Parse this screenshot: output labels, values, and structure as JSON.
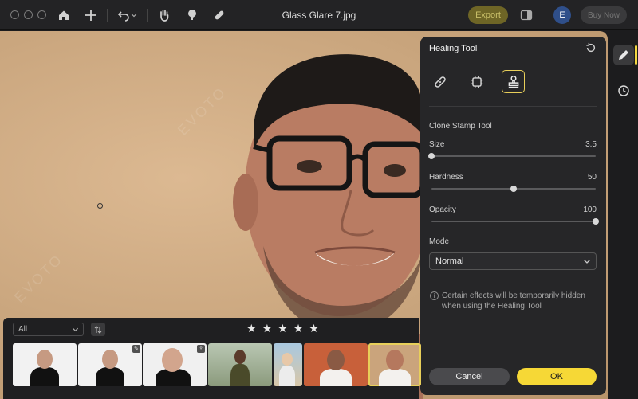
{
  "window": {
    "title": "Glass Glare 7.jpg"
  },
  "toolbar": {
    "export_label": "Export",
    "avatar_initial": "E",
    "buy_label": "Buy Now"
  },
  "panel": {
    "title": "Healing Tool",
    "tools": [
      {
        "name": "bandage-icon"
      },
      {
        "name": "chip-icon"
      },
      {
        "name": "stamp-icon",
        "active": true
      }
    ],
    "section": "Clone Stamp Tool",
    "sliders": [
      {
        "label": "Size",
        "value": "3.5",
        "fraction": 0.0
      },
      {
        "label": "Hardness",
        "value": "50",
        "fraction": 0.5
      },
      {
        "label": "Opacity",
        "value": "100",
        "fraction": 1.0
      }
    ],
    "mode_label": "Mode",
    "mode_value": "Normal",
    "info_text": "Certain effects will be temporarily hidden when using the Healing Tool",
    "cancel_label": "Cancel",
    "ok_label": "OK"
  },
  "filmstrip": {
    "filter_value": "All",
    "rating": 5,
    "thumbnails": 8
  },
  "colors": {
    "accent": "#f6d836",
    "backdrop": "#c9a57d",
    "panel": "#262628"
  }
}
